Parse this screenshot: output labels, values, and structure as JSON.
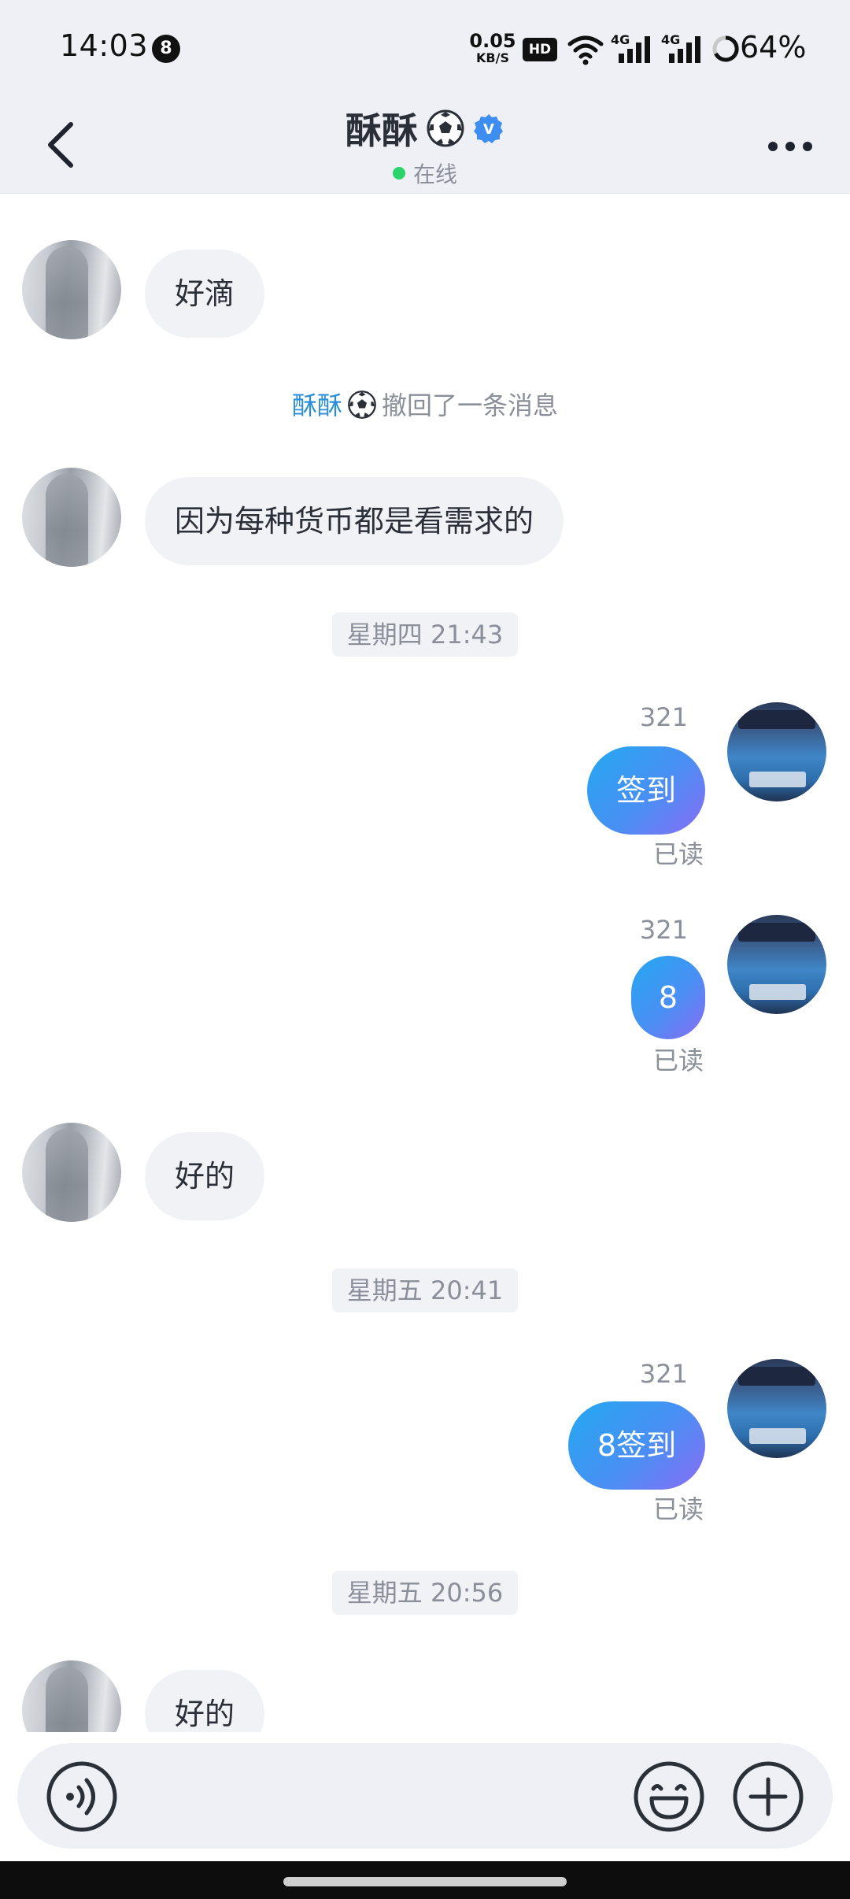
{
  "status_bar": {
    "time": "14:03",
    "notification_count": "8",
    "net_speed_value": "0.05",
    "net_speed_unit": "KB/S",
    "hd_label": "HD",
    "signal1_label": "4G",
    "signal2_label": "4G",
    "battery_percent": "64%"
  },
  "header": {
    "contact_name": "酥酥",
    "status_text": "在线",
    "status_color": "#2ad46a",
    "verified_badge": "V",
    "icons": [
      "back-icon",
      "soccer-ball-icon",
      "verified-icon",
      "more-icon"
    ]
  },
  "messages": [
    {
      "type": "incoming",
      "text": "好滴"
    },
    {
      "type": "system",
      "name": "酥酥",
      "text": "撤回了一条消息"
    },
    {
      "type": "incoming",
      "text": "因为每种货币都是看需求的"
    },
    {
      "type": "time",
      "text": "星期四 21:43"
    },
    {
      "type": "outgoing",
      "sender": "321",
      "text": "签到",
      "receipt": "已读"
    },
    {
      "type": "outgoing",
      "sender": "321",
      "text": "8",
      "receipt": "已读"
    },
    {
      "type": "incoming",
      "text": "好的"
    },
    {
      "type": "time",
      "text": "星期五 20:41"
    },
    {
      "type": "outgoing",
      "sender": "321",
      "text": "8签到",
      "receipt": "已读"
    },
    {
      "type": "time",
      "text": "星期五 20:56"
    },
    {
      "type": "incoming",
      "text": "好的"
    }
  ],
  "theme": {
    "bubble_out_gradient": [
      "#23a8f0",
      "#8a6cf4"
    ],
    "bubble_in_color": "#f1f2f6",
    "header_bg": "#eef0f5",
    "recall_name_color": "#2a8fd8"
  },
  "input_bar": {
    "icons": [
      "voice-icon",
      "emoji-icon",
      "plus-icon"
    ]
  }
}
